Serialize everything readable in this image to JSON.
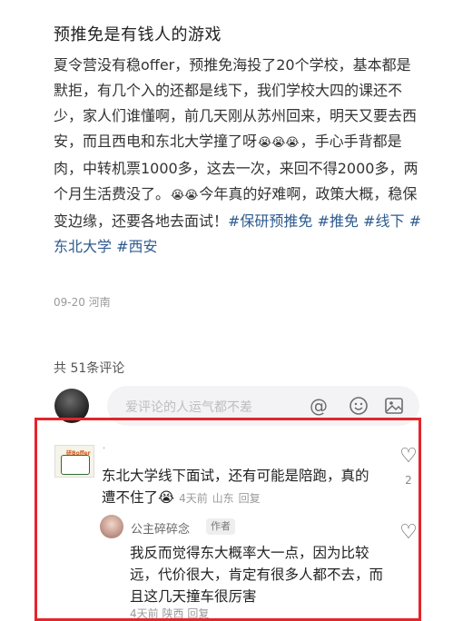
{
  "post": {
    "title": "预推免是有钱人的游戏",
    "body_part1": "夏令营没有稳offer，预推免海投了20个学校，基本都是默拒，有几个入的还都是线下，我们学校大四的课还不少，家人们谁懂啊，前几天刚从苏州回来，明天又要去西安，而且西电和东北大学撞了呀",
    "emoji_run1": "😭😭😭",
    "body_part2": "，手心手背都是肉，中转机票1000多，这去一次，来回不得2000多，两个月生活费没了。",
    "emoji_run2": "😭😭",
    "body_part3": "今年真的好难啊，政策大概，稳保变边缘，还要各地去面试！",
    "tags": [
      "#保研预推免",
      "#推免",
      "#线下",
      "#东北大学",
      "#西安"
    ],
    "date_location": "09-20 河南"
  },
  "comments_section": {
    "count_label": "共 51条评论",
    "input_placeholder": "爱评论的人运气都不差",
    "icons": [
      "at-icon",
      "emoji-icon",
      "image-icon"
    ]
  },
  "comment1": {
    "avatar_logo": "研Boffer",
    "username": "·",
    "text": "东北大学线下面试，还有可能是陪跑，真的遭不住了",
    "emoji": "😭",
    "time": "4天前",
    "location": "山东",
    "reply_label": "回复",
    "likes": "2"
  },
  "reply1": {
    "username": "公主碎碎念",
    "badge": "作者",
    "text": "我反而觉得东大概率大一点，因为比较远，代价很大，肯定有很多人都不去，而且这几天撞车很厉害",
    "time": "4天前",
    "location": "陕西",
    "reply_label": "回复"
  },
  "colors": {
    "highlight_border": "#e5252a",
    "tag": "#2f5b8f"
  }
}
